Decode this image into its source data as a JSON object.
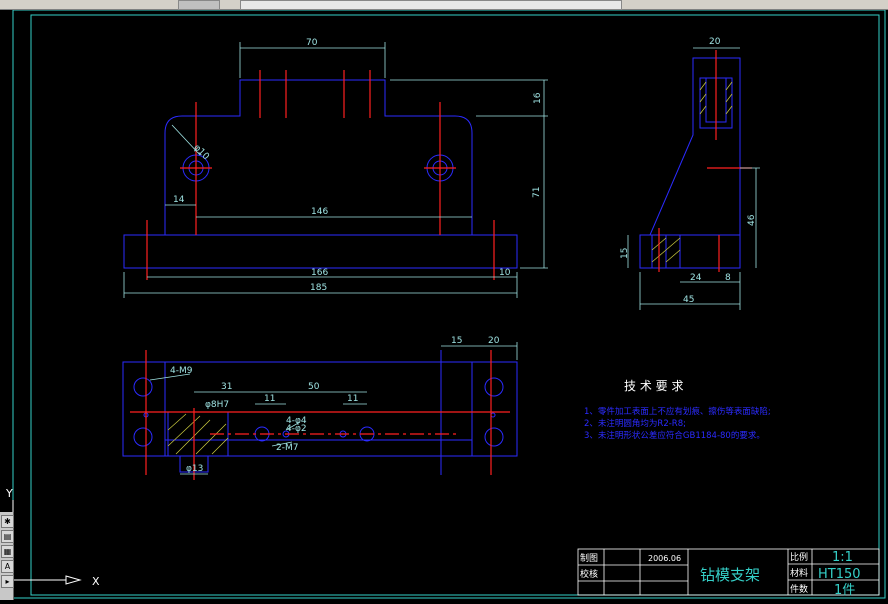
{
  "drawing": {
    "front_view_dims": {
      "top_width": "70",
      "overall_width": "185",
      "base_width": "166",
      "hole_spacing": "146",
      "hole_edge": "14",
      "right_edge": "10",
      "step_height": "16",
      "total_height": "71",
      "hole_dia": "φ10"
    },
    "side_view_dims": {
      "top_width": "20",
      "height": "46",
      "base_height": "15",
      "base_a": "24",
      "base_b": "8",
      "overall": "45"
    },
    "top_view_dims": {
      "w31": "31",
      "w50": "50",
      "w11a": "11",
      "w11b": "11",
      "w15": "15",
      "w20": "20",
      "thread1": "4-M9",
      "fit": "φ8H7",
      "small_holes": "4-φ4",
      "tiny_holes": "4-φ2",
      "tapped": "2-M7",
      "bottom_dia": "φ13"
    },
    "requirements": {
      "title": "技 术 要 求",
      "items": [
        "1、零件加工表面上不应有划痕、擦伤等表面缺陷;",
        "2、未注明圆角均为R2-R8;",
        "3、未注明形状公差应符合GB1184-80的要求。"
      ]
    },
    "title_block": {
      "drawn_label": "制图",
      "check_label": "校核",
      "date": "2006.06",
      "part_name": "钻模支架",
      "scale_label": "比例",
      "scale": "1:1",
      "material_label": "材料",
      "material": "HT150",
      "qty_label": "件数",
      "qty": "1件"
    },
    "ucs": {
      "y_label": "Y",
      "x_label": "X"
    }
  },
  "colors": {
    "background": "#000000",
    "outline": "#2b2bff",
    "dimension": "#9fe3e3",
    "center": "#ff2020",
    "text": "#ffffff",
    "frame": "#35d0c8"
  }
}
